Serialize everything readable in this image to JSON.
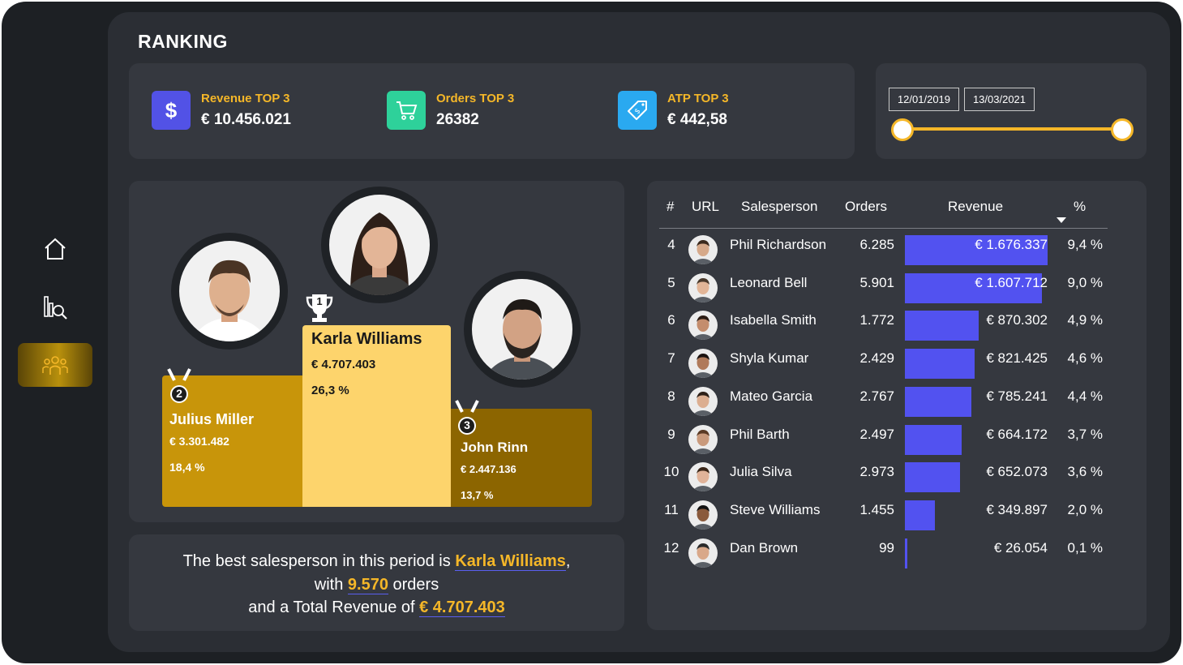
{
  "page": {
    "title": "RANKING"
  },
  "sidebar": {
    "items": [
      {
        "name": "home-icon",
        "active": false
      },
      {
        "name": "analytics-icon",
        "active": false
      },
      {
        "name": "team-icon",
        "active": true
      }
    ]
  },
  "kpis": [
    {
      "label": "Revenue TOP 3",
      "value": "€ 10.456.021",
      "icon": "dollar-icon",
      "color": "#5252e6"
    },
    {
      "label": "Orders TOP 3",
      "value": "26382",
      "icon": "cart-icon",
      "color": "#2ed19a"
    },
    {
      "label": "ATP TOP 3",
      "value": "€ 442,58",
      "icon": "price-tag-icon",
      "color": "#2aa9f0"
    }
  ],
  "date_range": {
    "start": "12/01/2019",
    "end": "13/03/2021"
  },
  "podium": {
    "first": {
      "rank": "1",
      "name": "Karla Williams",
      "revenue": "€ 4.707.403",
      "pct": "26,3 %",
      "color": "#fdd46c"
    },
    "second": {
      "rank": "2",
      "name": "Julius Miller",
      "revenue": "€ 3.301.482",
      "pct": "18,4 %",
      "color": "#c8950a"
    },
    "third": {
      "rank": "3",
      "name": "John Rinn",
      "revenue": "€ 2.447.136",
      "pct": "13,7 %",
      "color": "#8c6500"
    }
  },
  "summary": {
    "line1_prefix": "The best salesperson in this period is ",
    "best_name": "Karla Williams",
    "line1_suffix": ",",
    "line2_prefix": "with ",
    "orders": "9.570",
    "line2_suffix": " orders",
    "line3_prefix": "and a Total Revenue of ",
    "revenue": "€ 4.707.403"
  },
  "table": {
    "headers": {
      "rank": "#",
      "url": "URL",
      "salesperson": "Salesperson",
      "orders": "Orders",
      "revenue": "Revenue",
      "pct": "%"
    },
    "sort": {
      "column": "%",
      "direction": "descending"
    },
    "bar_color": "#5252f0",
    "rows": [
      {
        "rank": "4",
        "name": "Phil Richardson",
        "orders": "6.285",
        "revenue": "€ 1.676.337",
        "pct": "9,4 %",
        "revenue_value": 1676337
      },
      {
        "rank": "5",
        "name": "Leonard Bell",
        "orders": "5.901",
        "revenue": "€ 1.607.712",
        "pct": "9,0 %",
        "revenue_value": 1607712
      },
      {
        "rank": "6",
        "name": "Isabella Smith",
        "orders": "1.772",
        "revenue": "€ 870.302",
        "pct": "4,9 %",
        "revenue_value": 870302
      },
      {
        "rank": "7",
        "name": "Shyla Kumar",
        "orders": "2.429",
        "revenue": "€ 821.425",
        "pct": "4,6 %",
        "revenue_value": 821425
      },
      {
        "rank": "8",
        "name": "Mateo Garcia",
        "orders": "2.767",
        "revenue": "€ 785.241",
        "pct": "4,4 %",
        "revenue_value": 785241
      },
      {
        "rank": "9",
        "name": "Phil Barth",
        "orders": "2.497",
        "revenue": "€ 664.172",
        "pct": "3,7 %",
        "revenue_value": 664172
      },
      {
        "rank": "10",
        "name": "Julia Silva",
        "orders": "2.973",
        "revenue": "€ 652.073",
        "pct": "3,6 %",
        "revenue_value": 652073
      },
      {
        "rank": "11",
        "name": "Steve Williams",
        "orders": "1.455",
        "revenue": "€ 349.897",
        "pct": "2,0 %",
        "revenue_value": 349897
      },
      {
        "rank": "12",
        "name": "Dan Brown",
        "orders": "99",
        "revenue": "€ 26.054",
        "pct": "0,1 %",
        "revenue_value": 26054
      }
    ]
  }
}
